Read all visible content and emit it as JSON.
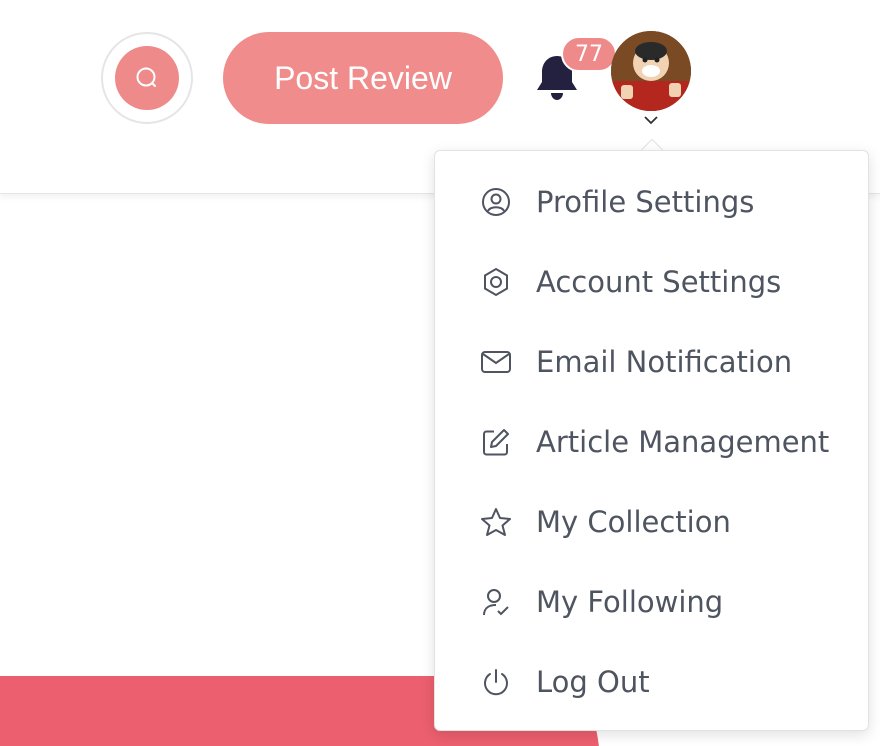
{
  "header": {
    "post_review_label": "Post Review",
    "notification_count": "77"
  },
  "colors": {
    "accent": "#ef8a8a",
    "bell": "#23213f",
    "strip": "#ec5f6e",
    "menu_text": "#4e5560"
  },
  "menu": {
    "items": [
      {
        "label": "Profile Settings",
        "icon": "user-circle-icon"
      },
      {
        "label": "Account Settings",
        "icon": "hexagon-settings-icon"
      },
      {
        "label": "Email Notification",
        "icon": "mail-icon"
      },
      {
        "label": "Article Management",
        "icon": "edit-icon"
      },
      {
        "label": "My Collection",
        "icon": "star-icon"
      },
      {
        "label": "My Following",
        "icon": "user-check-icon"
      },
      {
        "label": "Log Out",
        "icon": "power-icon"
      }
    ]
  }
}
